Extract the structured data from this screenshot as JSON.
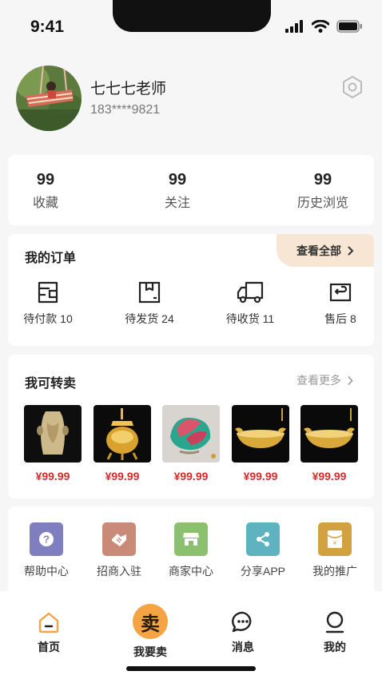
{
  "status_bar": {
    "time": "9:41"
  },
  "profile": {
    "name": "七七七老师",
    "phone": "183****9821",
    "settings_icon": "hexagon-settings-icon"
  },
  "stats": [
    {
      "value": "99",
      "label": "收藏"
    },
    {
      "value": "99",
      "label": "关注"
    },
    {
      "value": "99",
      "label": "历史浏览"
    }
  ],
  "orders": {
    "title": "我的订单",
    "view_all": "查看全部",
    "items": [
      {
        "label": "待付款 10",
        "icon": "wallet-icon"
      },
      {
        "label": "待发货 24",
        "icon": "package-icon"
      },
      {
        "label": "待收货 11",
        "icon": "truck-icon"
      },
      {
        "label": "售后 8",
        "icon": "return-icon"
      }
    ]
  },
  "resell": {
    "title": "我可转卖",
    "see_more": "查看更多",
    "products": [
      {
        "price": "¥99.99",
        "image": "jade-vase"
      },
      {
        "price": "¥99.99",
        "image": "gold-censer"
      },
      {
        "price": "¥99.99",
        "image": "enamel-lotus-cup"
      },
      {
        "price": "¥99.99",
        "image": "gold-dragon-bowl"
      },
      {
        "price": "¥99.99",
        "image": "gold-dragon-bowl"
      }
    ]
  },
  "tools": [
    {
      "label": "帮助中心",
      "icon": "help-icon",
      "color": "#7f7fbf"
    },
    {
      "label": "招商入驻",
      "icon": "handshake-icon",
      "color": "#c98b78"
    },
    {
      "label": "商家中心",
      "icon": "store-icon",
      "color": "#8bc06f"
    },
    {
      "label": "分享APP",
      "icon": "share-icon",
      "color": "#5fb3c0"
    },
    {
      "label": "我的推广",
      "icon": "red-envelope-icon",
      "color": "#d2a240"
    }
  ],
  "tabbar": {
    "items": [
      {
        "label": "首页",
        "icon": "home-icon"
      },
      {
        "label": "我要卖",
        "icon_text": "卖"
      },
      {
        "label": "消息",
        "icon": "chat-icon"
      },
      {
        "label": "我的",
        "icon": "person-icon"
      }
    ],
    "accent": "#f4a442"
  }
}
